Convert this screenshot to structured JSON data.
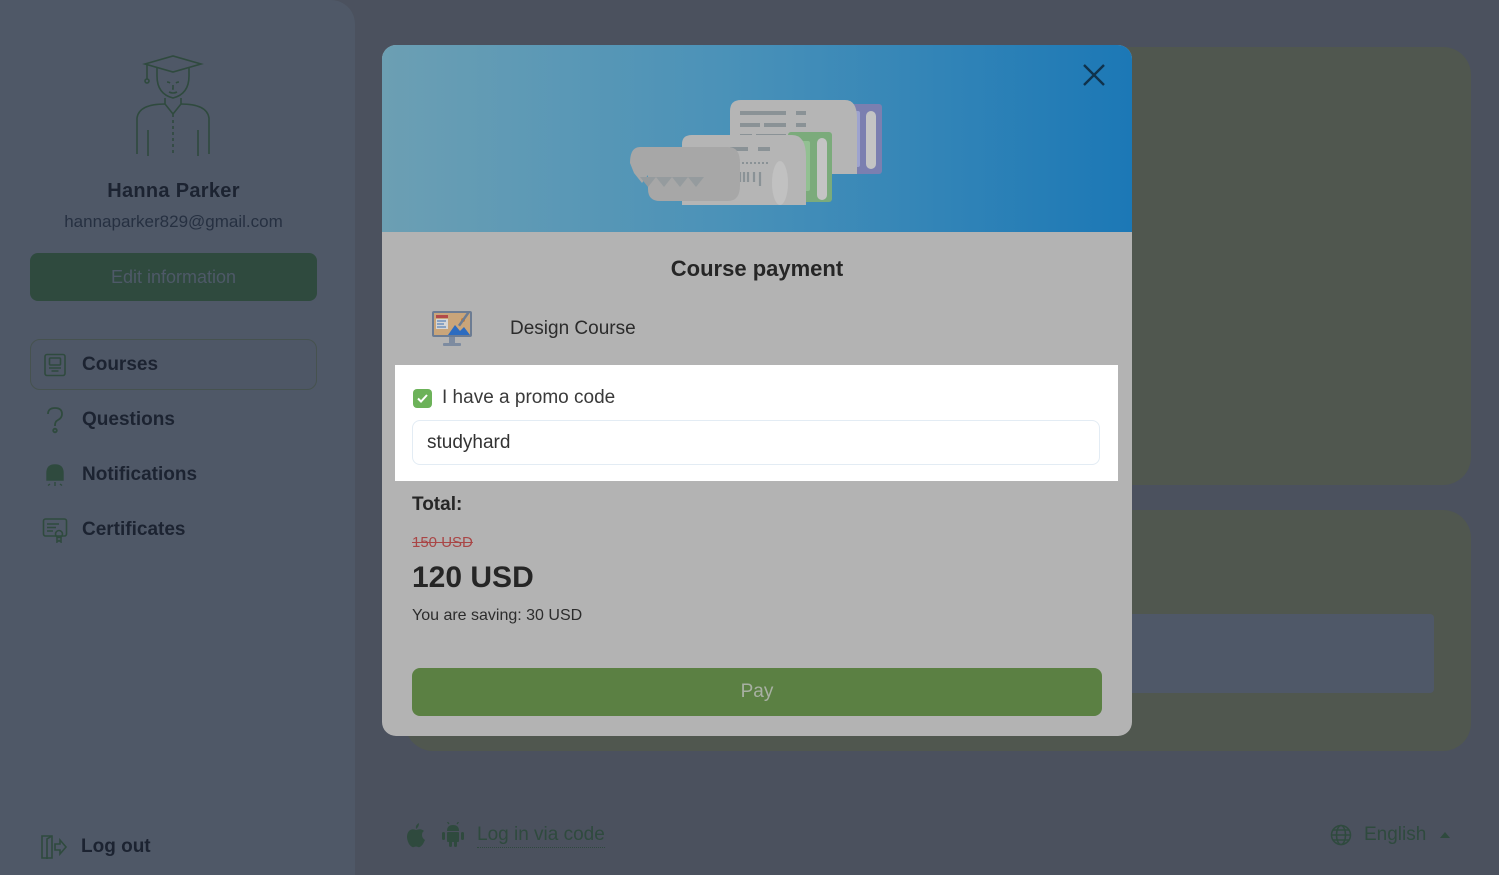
{
  "sidebar": {
    "user": {
      "name": "Hanna Parker",
      "email": "hannaparker829@gmail.com",
      "avatar_icon": "graduate-avatar-icon"
    },
    "edit_button": "Edit information",
    "nav": [
      {
        "label": "Courses",
        "icon": "courses-icon",
        "active": true
      },
      {
        "label": "Questions",
        "icon": "question-icon",
        "active": false
      },
      {
        "label": "Notifications",
        "icon": "bell-icon",
        "active": false
      },
      {
        "label": "Certificates",
        "icon": "certificate-icon",
        "active": false
      }
    ],
    "logout": "Log out"
  },
  "footer": {
    "login_code_link": "Log in via code",
    "platform_icons": [
      "apple-icon",
      "android-icon"
    ],
    "language": "English"
  },
  "modal": {
    "title": "Course payment",
    "course_name": "Design Course",
    "promo": {
      "checkbox_label": "I have a promo code",
      "checked": true,
      "input_value": "studyhard"
    },
    "total_label": "Total:",
    "old_price": "150 USD",
    "new_price": "120 USD",
    "saving_text": "You are saving: 30 USD",
    "pay_button": "Pay"
  },
  "colors": {
    "accent_green": "#5b8043",
    "checkbox_green": "#6cb259",
    "header_blue": "#1c78b6",
    "old_price_red": "#a94646"
  }
}
